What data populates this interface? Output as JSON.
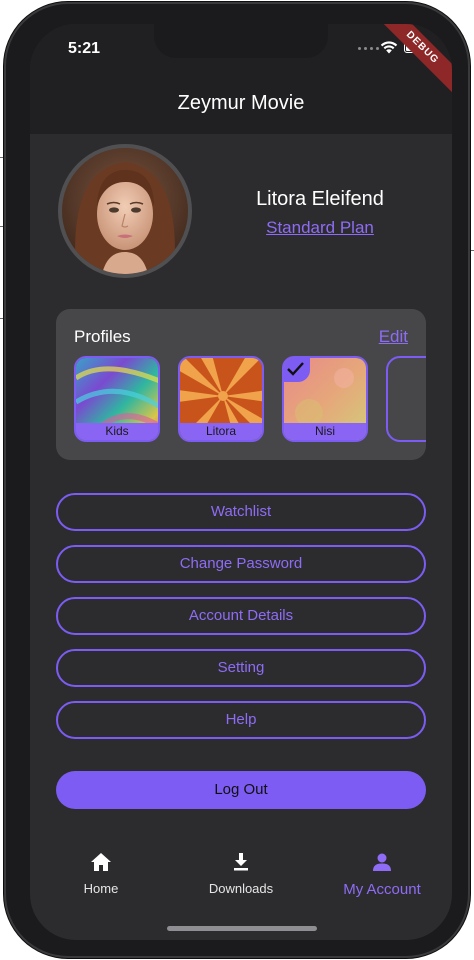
{
  "status_bar": {
    "time": "5:21",
    "debug_banner": "DEBUG"
  },
  "app_bar": {
    "title": "Zeymur Movie"
  },
  "user": {
    "name": "Litora Eleifend",
    "plan": "Standard Plan"
  },
  "profiles": {
    "title": "Profiles",
    "edit_label": "Edit",
    "items": [
      {
        "label": "Kids",
        "selected": false
      },
      {
        "label": "Litora",
        "selected": false
      },
      {
        "label": "Nisi",
        "selected": true
      }
    ]
  },
  "menu": {
    "watchlist": "Watchlist",
    "change_password": "Change Password",
    "account_details": "Account Details",
    "setting": "Setting",
    "help": "Help",
    "logout": "Log Out"
  },
  "bottom_nav": {
    "items": [
      {
        "label": "Home",
        "icon": "home-icon",
        "active": false
      },
      {
        "label": "Downloads",
        "icon": "download-icon",
        "active": false
      },
      {
        "label": "My Account",
        "icon": "person-icon",
        "active": true
      }
    ]
  },
  "colors": {
    "accent": "#7c5cf2",
    "background": "#2c2c2e",
    "card": "#474749"
  }
}
